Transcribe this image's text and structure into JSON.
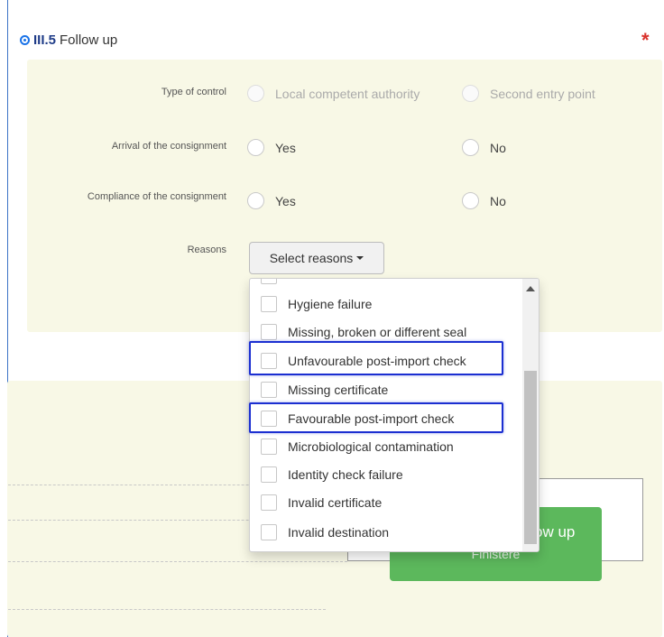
{
  "section": {
    "id": "III.5",
    "title": "Follow up",
    "required_mark": "*"
  },
  "form": {
    "type_of_control": {
      "label": "Type of control",
      "options": [
        "Local competent authority",
        "Second entry point"
      ]
    },
    "arrival": {
      "label": "Arrival of the consignment",
      "options": [
        "Yes",
        "No"
      ]
    },
    "compliance": {
      "label": "Compliance of the consignment",
      "options": [
        "Yes",
        "No"
      ]
    },
    "reasons": {
      "label": "Reasons",
      "button_label": "Select reasons",
      "items": [
        "Hygiene failure",
        "Missing, broken or different seal",
        "Unfavourable post-import check",
        "Missing certificate",
        "Favourable post-import check",
        "Microbiological contamination",
        "Identity check failure",
        "Invalid certificate",
        "Invalid destination"
      ]
    }
  },
  "followup_button": {
    "label_partial": "ow up",
    "sub_label": "Finistere"
  },
  "colors": {
    "panel_bg": "#f8f8e6",
    "accent_green": "#5cb85c",
    "highlight_blue": "#1b2fd1",
    "required_red": "#d9302a"
  }
}
